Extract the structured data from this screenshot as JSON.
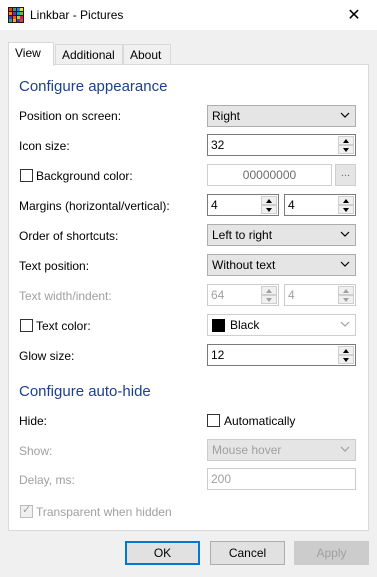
{
  "window": {
    "title": "Linkbar - Pictures",
    "close_glyph": "✕"
  },
  "tabs": [
    {
      "label": "View",
      "active": true
    },
    {
      "label": "Additional",
      "active": false
    },
    {
      "label": "About",
      "active": false
    }
  ],
  "appearance": {
    "section_title": "Configure appearance",
    "position": {
      "label": "Position on screen:",
      "value": "Right"
    },
    "icon_size": {
      "label": "Icon size:",
      "value": "32"
    },
    "background_color": {
      "label": "Background color:",
      "checked": false,
      "value": "00000000",
      "button": "..."
    },
    "margins": {
      "label": "Margins (horizontal/vertical):",
      "horizontal": "4",
      "vertical": "4"
    },
    "order": {
      "label": "Order of shortcuts:",
      "value": "Left to right"
    },
    "text_position": {
      "label": "Text position:",
      "value": "Without text"
    },
    "text_width": {
      "label": "Text width/indent:",
      "width": "64",
      "indent": "4"
    },
    "text_color": {
      "label": "Text color:",
      "checked": false,
      "value": "Black",
      "swatch": "#000000"
    },
    "glow_size": {
      "label": "Glow size:",
      "value": "12"
    }
  },
  "autohide": {
    "section_title": "Configure auto-hide",
    "hide": {
      "label": "Hide:",
      "checkbox_label": "Automatically",
      "checked": false
    },
    "show": {
      "label": "Show:",
      "value": "Mouse hover"
    },
    "delay": {
      "label": "Delay, ms:",
      "value": "200"
    },
    "transparent": {
      "label": "Transparent when hidden",
      "checked": true
    }
  },
  "buttons": {
    "ok": "OK",
    "cancel": "Cancel",
    "apply": "Apply"
  },
  "colors": {
    "section_title": "#1c3f8f",
    "default_button_border": "#0078d7"
  }
}
